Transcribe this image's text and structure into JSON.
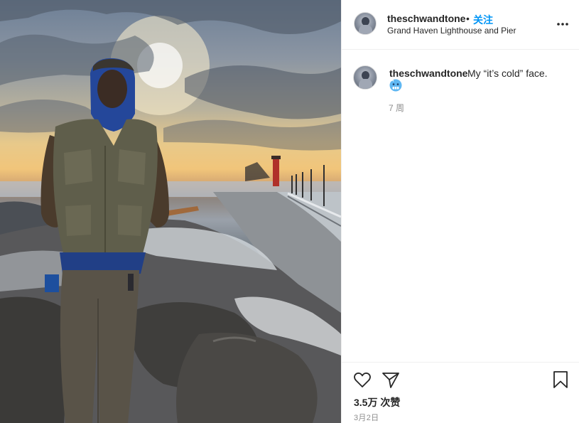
{
  "post": {
    "photo_alt": "Man in hooded jacket standing on rocks at Grand Haven Lighthouse and Pier at sunset",
    "header": {
      "username": "theschwandtone",
      "separator": "•",
      "follow_label": "关注",
      "location": "Grand Haven Lighthouse and Pier",
      "more_icon": "more-horizontal-icon"
    },
    "caption": {
      "username": "theschwandtone",
      "text": "My “it’s cold” face.",
      "emoji": "cold-face-emoji",
      "time_ago": "7 周"
    },
    "actions": {
      "like_icon": "heart-icon",
      "share_icon": "paper-plane-icon",
      "save_icon": "bookmark-icon",
      "likes": "3.5万 次赞",
      "date": "3月2日"
    }
  },
  "colors": {
    "accent": "#0095f6",
    "text": "#262626",
    "muted": "#8e8e8e",
    "divider": "#efefef"
  }
}
